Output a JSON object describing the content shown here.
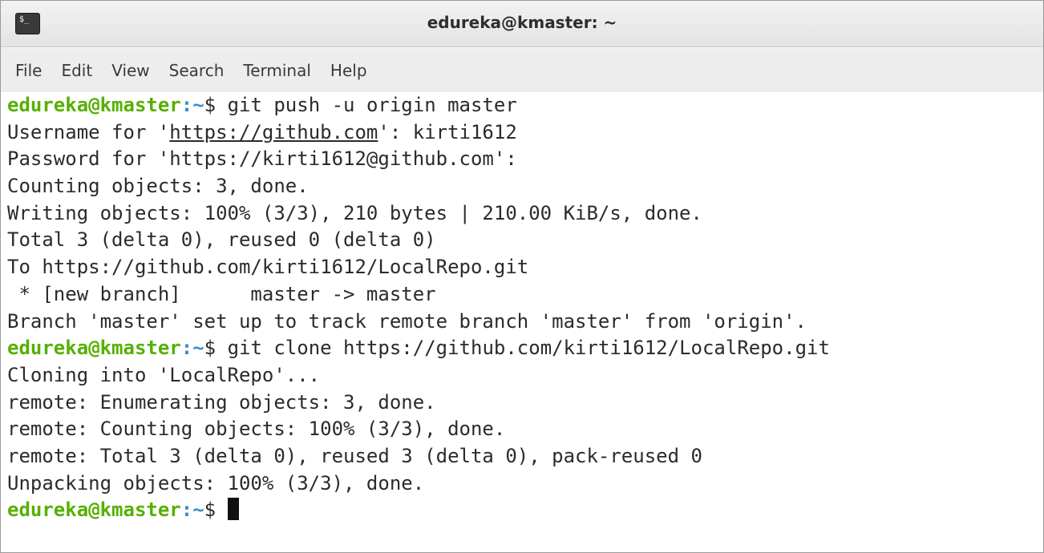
{
  "window": {
    "title": "edureka@kmaster: ~",
    "icon": "terminal-icon",
    "icon_glyph": "$_"
  },
  "menu": {
    "items": [
      "File",
      "Edit",
      "View",
      "Search",
      "Terminal",
      "Help"
    ]
  },
  "prompt": {
    "user_host": "edureka@kmaster",
    "path": ":~",
    "symbol": "$ "
  },
  "terminal": {
    "lines": [
      {
        "type": "prompt",
        "command": "git push -u origin master"
      },
      {
        "type": "output",
        "parts": [
          {
            "text": "Username for '"
          },
          {
            "text": "https://github.com",
            "link": true
          },
          {
            "text": "': kirti1612"
          }
        ]
      },
      {
        "type": "output",
        "text": "Password for 'https://kirti1612@github.com':"
      },
      {
        "type": "output",
        "text": "Counting objects: 3, done."
      },
      {
        "type": "output",
        "text": "Writing objects: 100% (3/3), 210 bytes | 210.00 KiB/s, done."
      },
      {
        "type": "output",
        "text": "Total 3 (delta 0), reused 0 (delta 0)"
      },
      {
        "type": "output",
        "text": "To https://github.com/kirti1612/LocalRepo.git"
      },
      {
        "type": "output",
        "text": " * [new branch]      master -> master"
      },
      {
        "type": "output",
        "text": "Branch 'master' set up to track remote branch 'master' from 'origin'."
      },
      {
        "type": "prompt",
        "command": "git clone https://github.com/kirti1612/LocalRepo.git"
      },
      {
        "type": "output",
        "text": "Cloning into 'LocalRepo'..."
      },
      {
        "type": "output",
        "text": "remote: Enumerating objects: 3, done."
      },
      {
        "type": "output",
        "text": "remote: Counting objects: 100% (3/3), done."
      },
      {
        "type": "output",
        "text": "remote: Total 3 (delta 0), reused 3 (delta 0), pack-reused 0"
      },
      {
        "type": "output",
        "text": "Unpacking objects: 100% (3/3), done."
      },
      {
        "type": "prompt",
        "command": "",
        "cursor": true
      }
    ]
  },
  "colors": {
    "prompt_user": "#56b000",
    "prompt_path": "#3b8ec8",
    "text": "#2b2b2b",
    "background": "#ffffff"
  }
}
